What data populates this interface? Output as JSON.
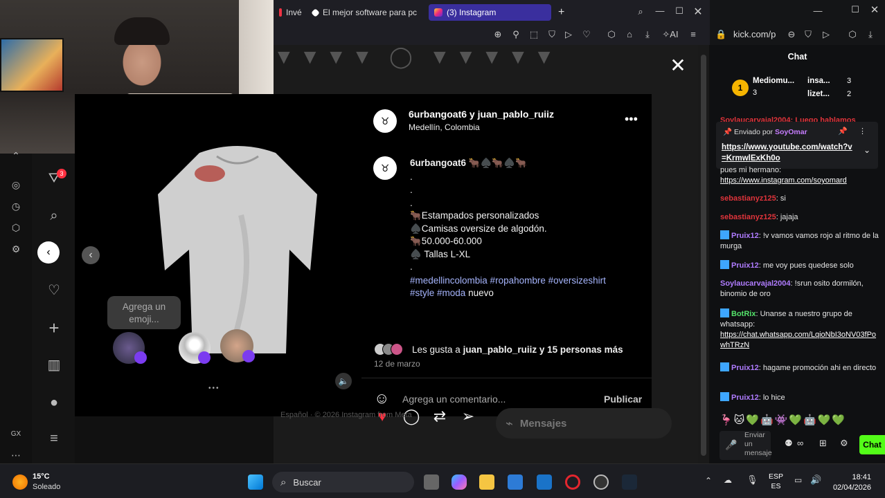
{
  "tabs": [
    {
      "label": "Invé"
    },
    {
      "label": "El mejor software para pc"
    },
    {
      "label": "(3) Instagram"
    }
  ],
  "kick": {
    "url": "kick.com/p",
    "chat_title": "Chat"
  },
  "post": {
    "header_users": "6urbangoat6 y juan_pablo_ruiiz",
    "location": "Medellín, Colombia",
    "author": "6urbangoat6",
    "author_emojis": "🐂♠️🐂♠️🐂",
    "caption_lines": [
      ".",
      ".",
      ".",
      "🐂Estampados personalizados",
      "♠️Camisas oversize de algodón.",
      "🐂50.000-60.000",
      "♠️ Tallas L-XL",
      "."
    ],
    "hashtags": "#medellincolombia #ropahombre #oversizeshirt #style #moda",
    "caption_end": "nuevo",
    "likes_prefix": "Les gusta a ",
    "likes_user": "juan_pablo_ruiiz",
    "likes_suffix": " y 15 personas más",
    "date": "12 de marzo",
    "comment_placeholder": "Agrega un comentario...",
    "publish_label": "Publicar",
    "emoji_hint": "Agrega un emoji...",
    "messages_label": "Mensajes",
    "footer_hint": "Español · © 2026 Instagram from Meta"
  },
  "notif_count": "3",
  "chat": {
    "top_user": "Mediomu...",
    "top_user_count": "3",
    "rank_a": "insa...",
    "rank_a_count": "3",
    "rank_b": "lizet...",
    "rank_b_count": "2",
    "pinned_by_label": "Enviado por",
    "pinned_by_user": "SoyOmar",
    "pinned_link": "https://www.youtube.com/watch?v=KrmwlExKh0o",
    "partial_top": "Soylaucarvajal2004: Luego hablamos",
    "messages": [
      {
        "user": "",
        "text": "pues mi hermano:",
        "link": "https://www.instagram.com/soyomard"
      },
      {
        "user": "sebastianyz125",
        "text": ": si"
      },
      {
        "user": "sebastianyz125",
        "text": ": jajaja"
      },
      {
        "user": "Pruix12",
        "text": ": !v vamos vamos rojo al ritmo de la murga"
      },
      {
        "user": "Pruix12",
        "text": ": me voy pues quedese solo"
      },
      {
        "user": "Soylaucarvajal2004",
        "text": ": !srun osito dormilón, binomio de oro"
      },
      {
        "user": "BotRix",
        "text": ": Unanse a nuestro grupo de whatsapp:",
        "link": "https://chat.whatsapp.com/LqioNbI3oNV03fPowhTRzN"
      },
      {
        "user": "Pruix12",
        "text": ": hagame promoción ahi en directo"
      },
      {
        "user": "Pruix12",
        "text": ": lo hice"
      }
    ],
    "send_label": "Enviar un mensaje",
    "chat_button": "Chat"
  },
  "taskbar": {
    "weather_temp": "15°C",
    "weather_desc": "Soleado",
    "search_label": "Buscar",
    "lang_top": "ESP",
    "lang_bottom": "ES",
    "time": "18:41",
    "date": "02/04/2026"
  },
  "sidebar_gx": "GX"
}
